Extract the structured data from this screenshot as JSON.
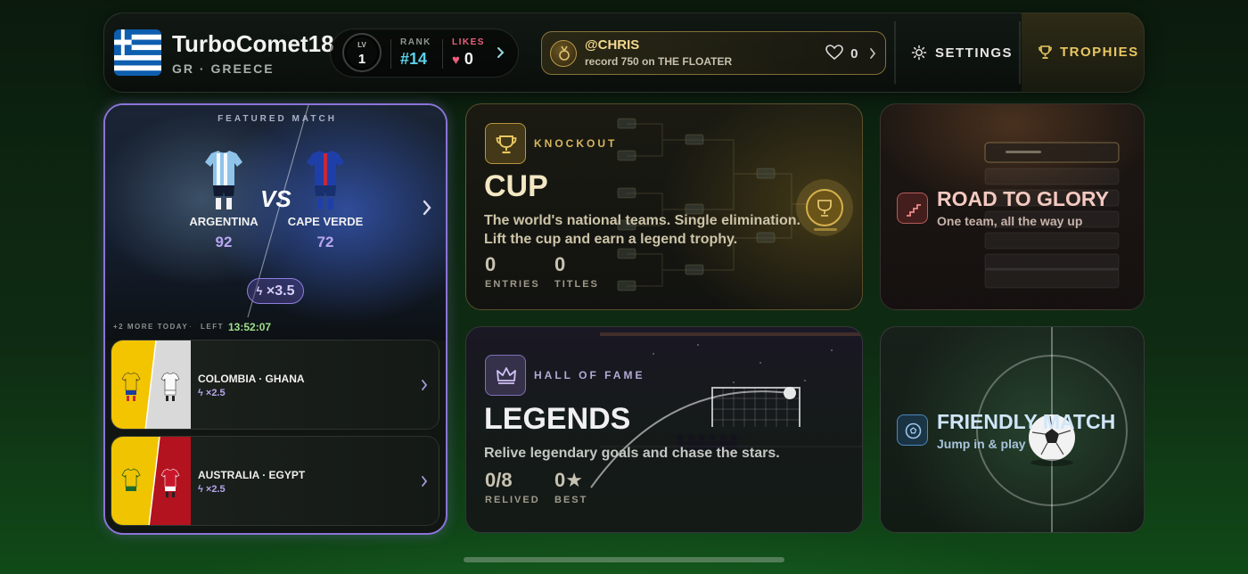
{
  "profile": {
    "username": "TurboComet18",
    "country": "GR · GREECE",
    "level_label": "LV",
    "level": "1",
    "rank_label": "RANK",
    "rank": "#14",
    "likes_label": "LIKES",
    "likes": "0"
  },
  "record_banner": {
    "user": "@CHRIS",
    "text": "record 750 on THE FLOATER",
    "likes": "0"
  },
  "nav": {
    "settings": "SETTINGS",
    "trophies": "TROPHIES"
  },
  "featured": {
    "label": "FEATURED MATCH",
    "home_team": "ARGENTINA",
    "home_score": "92",
    "away_team": "CAPE VERDE",
    "away_score": "72",
    "vs": "VS",
    "multiplier": "×3.5",
    "more_today": "+2 MORE TODAY",
    "separator": "·",
    "left_label": "LEFT",
    "time_left": "13:52:07"
  },
  "matches": [
    {
      "name": "COLOMBIA · GHANA",
      "multiplier": "×2.5"
    },
    {
      "name": "AUSTRALIA · EGYPT",
      "multiplier": "×2.5"
    }
  ],
  "cup": {
    "eyebrow": "KNOCKOUT",
    "title": "CUP",
    "desc_line1": "The world's national teams. Single elimination.",
    "desc_line2": "Lift the cup and earn a legend trophy.",
    "entries": "0",
    "entries_label": "ENTRIES",
    "titles": "0",
    "titles_label": "TITLES"
  },
  "legends": {
    "eyebrow": "HALL OF FAME",
    "title": "LEGENDS",
    "desc": "Relive legendary goals and chase the stars.",
    "relived": "0/8",
    "relived_label": "RELIVED",
    "best": "0★",
    "best_label": "BEST"
  },
  "road": {
    "title": "ROAD TO GLORY",
    "subtitle": "One team, all the way up"
  },
  "friendly": {
    "title": "FRIENDLY MATCH",
    "subtitle": "Jump in & play"
  },
  "colors": {
    "accent_purple": "#8a74d6",
    "gold": "#e8c661",
    "likes_pink": "#ef5f7d",
    "rank_cyan": "#5bd0e8",
    "timer_green": "#9fe08a"
  }
}
